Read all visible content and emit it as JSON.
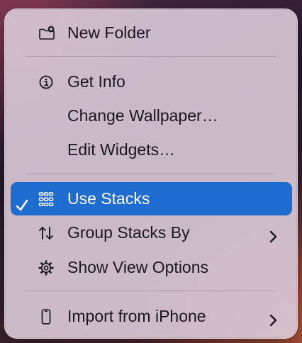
{
  "menu": {
    "items": [
      {
        "label": "New Folder",
        "icon": "folder-plus-icon"
      },
      {
        "label": "Get Info",
        "icon": "info-circle-icon"
      },
      {
        "label": "Change Wallpaper…"
      },
      {
        "label": "Edit Widgets…"
      },
      {
        "label": "Use Stacks",
        "icon": "stacks-grid-icon",
        "checked": true,
        "highlighted": true
      },
      {
        "label": "Group Stacks By",
        "icon": "sort-arrows-icon",
        "submenu": true
      },
      {
        "label": "Show View Options",
        "icon": "gear-icon"
      },
      {
        "label": "Import from iPhone",
        "icon": "iphone-icon",
        "submenu": true
      }
    ]
  },
  "colors": {
    "highlight": "#1f6ccf",
    "menu_background": "#d6c6d4",
    "text": "#1c1620"
  }
}
